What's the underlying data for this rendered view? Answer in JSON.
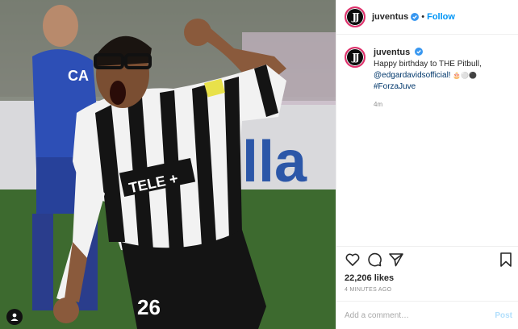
{
  "post": {
    "username": "juventus",
    "follow_label": "Follow",
    "separator": "•",
    "caption_line1": "Happy birthday to THE Pitbull,",
    "caption_mention": "@edgardavidsofficial!",
    "caption_emojis": "🎂⚪⚫",
    "caption_hashtag": "#ForzaJuve",
    "caption_time": "4m",
    "likes": "22,206 likes",
    "posted_ago": "4 MINUTES AGO",
    "comment_placeholder": "Add a comment…",
    "post_button": "Post"
  },
  "photo": {
    "jersey_number": "26",
    "sponsor_text": "TELE +",
    "banner_text": "lla",
    "opponent_shirt_text": "CA"
  },
  "icons": {
    "avatar": "juventus-logo-icon",
    "verified": "verified-badge-icon",
    "like": "heart-icon",
    "comment": "comment-icon",
    "share": "paper-plane-icon",
    "save": "bookmark-icon",
    "tag": "user-tag-icon"
  },
  "colors": {
    "follow_link": "#0095f6",
    "mention_link": "#00376b",
    "verified": "#3897f0",
    "post_button_disabled": "#b2dffc"
  }
}
